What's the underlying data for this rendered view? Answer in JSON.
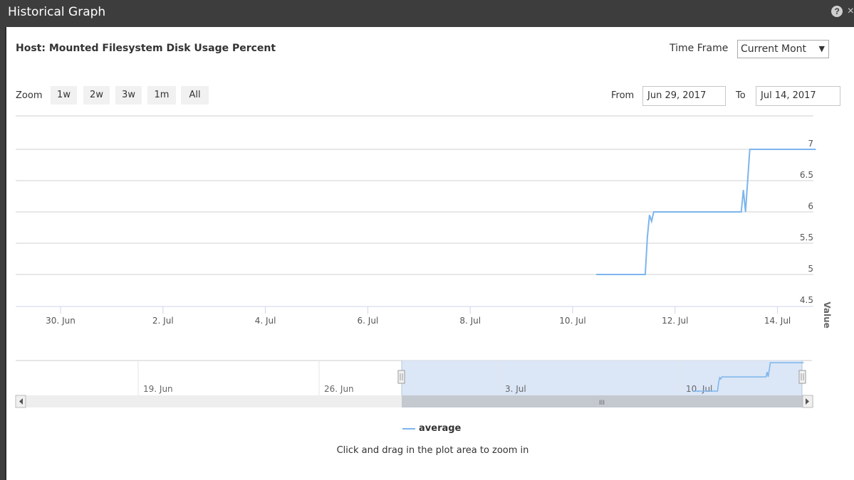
{
  "window": {
    "title": "Historical Graph",
    "help_icon": "?",
    "close_icon": "×"
  },
  "header": {
    "graph_title": "Host: Mounted Filesystem Disk Usage Percent",
    "time_frame_label": "Time Frame",
    "time_frame_value": "Current Mont"
  },
  "zoom": {
    "label": "Zoom",
    "buttons": [
      "1w",
      "2w",
      "3w",
      "1m",
      "All"
    ]
  },
  "range": {
    "from_label": "From",
    "from_value": "Jun 29, 2017",
    "to_label": "To",
    "to_value": "Jul 14, 2017"
  },
  "chart_data": {
    "type": "line",
    "ylabel": "Value",
    "ylim": [
      4.5,
      7
    ],
    "y_ticks": [
      "7",
      "6.5",
      "6",
      "5.5",
      "5",
      "4.5"
    ],
    "x_ticks": [
      "30. Jun",
      "2. Jul",
      "4. Jul",
      "6. Jul",
      "8. Jul",
      "10. Jul",
      "12. Jul",
      "14. Jul"
    ],
    "xlim": [
      "2017-06-29",
      "2017-07-14"
    ],
    "series": [
      {
        "name": "average",
        "color": "#7cb5ec",
        "points": [
          [
            "2017-07-10 11:00",
            5.0
          ],
          [
            "2017-07-11 10:00",
            5.0
          ],
          [
            "2017-07-11 11:00",
            5.6
          ],
          [
            "2017-07-11 12:00",
            5.95
          ],
          [
            "2017-07-11 13:00",
            5.85
          ],
          [
            "2017-07-11 14:00",
            6.0
          ],
          [
            "2017-07-13 07:00",
            6.0
          ],
          [
            "2017-07-13 08:00",
            6.35
          ],
          [
            "2017-07-13 09:00",
            6.0
          ],
          [
            "2017-07-13 11:00",
            7.0
          ],
          [
            "2017-07-14 18:00",
            7.0
          ]
        ]
      }
    ],
    "navigator": {
      "x_ticks": [
        "19. Jun",
        "26. Jun",
        "3. Jul",
        "10. Jul"
      ],
      "scrollbar_grip": "III"
    }
  },
  "legend": {
    "label": "average"
  },
  "hint": "Click and drag in the plot area to zoom in"
}
